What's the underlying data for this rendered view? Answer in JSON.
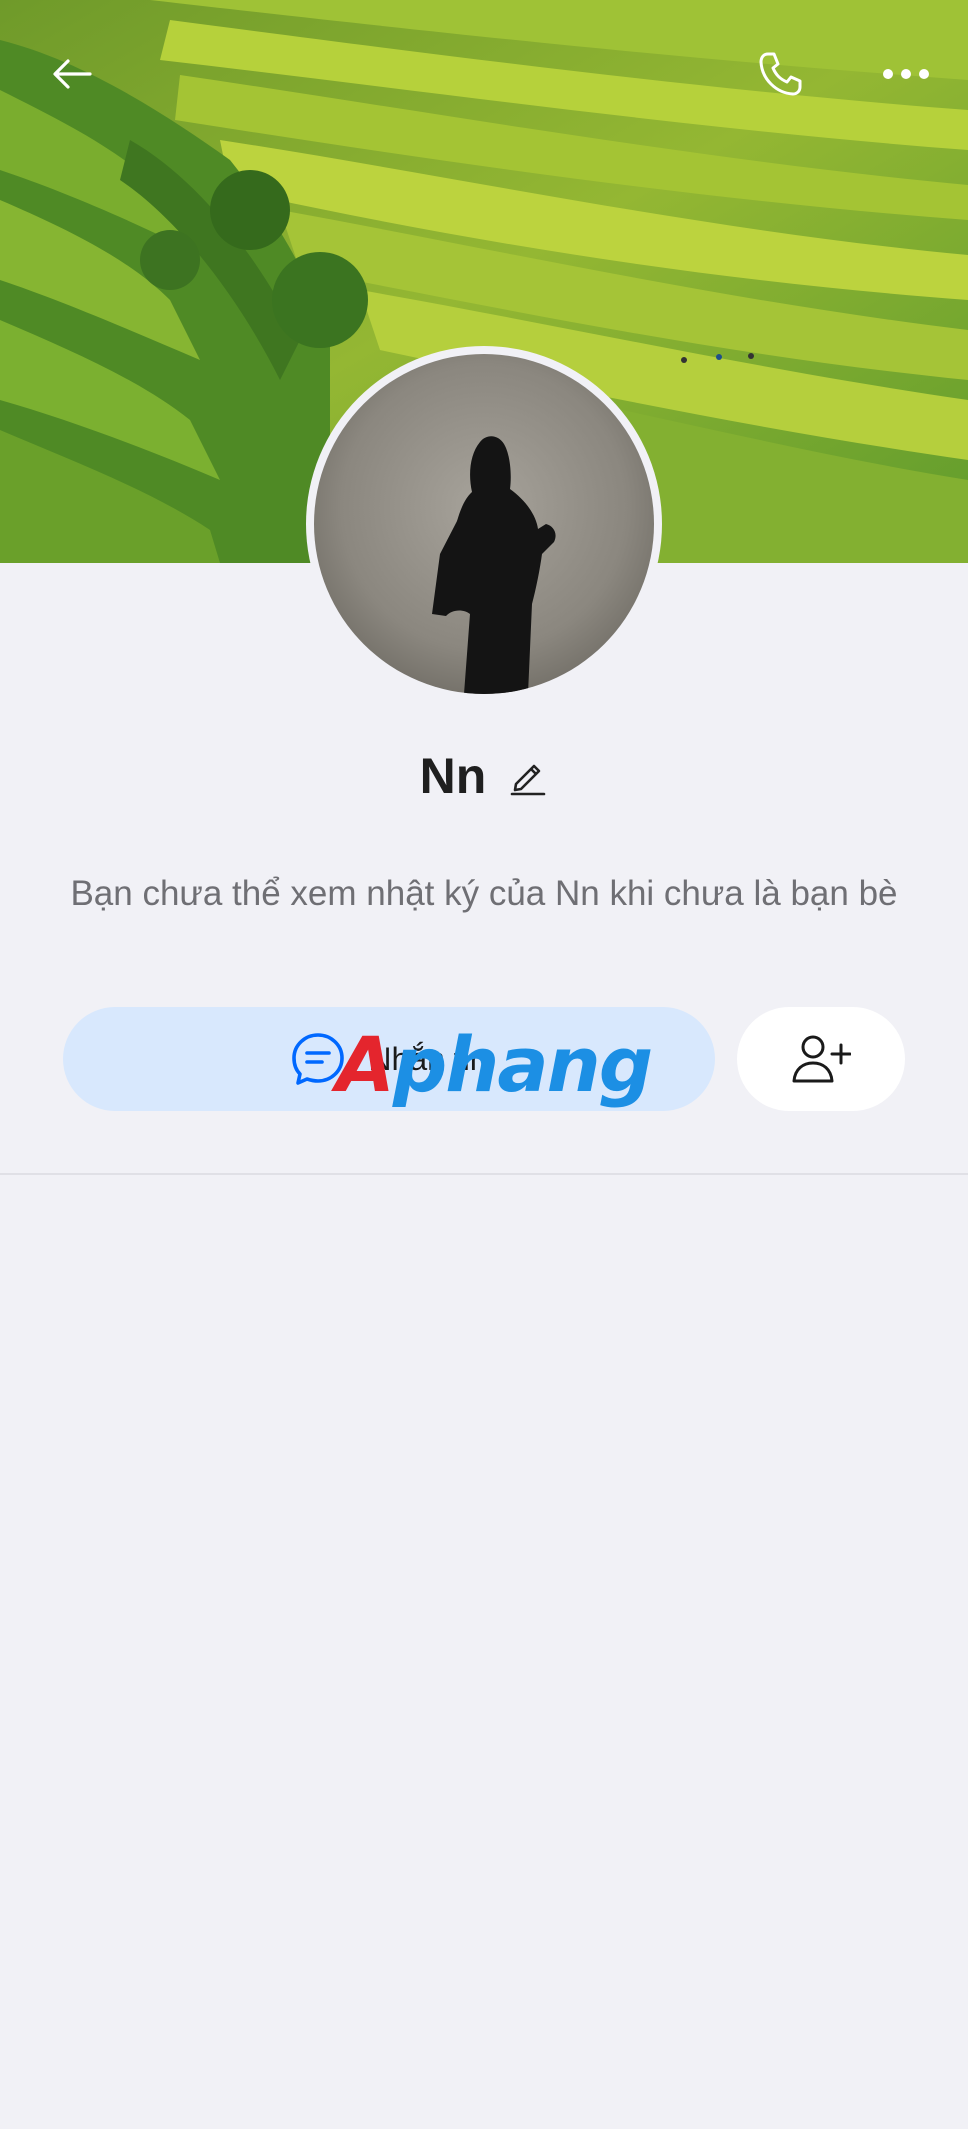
{
  "header": {
    "back_icon": "arrow-left-icon",
    "call_icon": "phone-icon",
    "more_icon": "more-horizontal-icon"
  },
  "profile": {
    "name": "Nn",
    "edit_icon": "pencil-icon",
    "notice": "Bạn chưa thể xem nhật ký của Nn khi chưa là bạn bè"
  },
  "actions": {
    "message_label": "Nhắn tin",
    "message_icon": "chat-bubble-icon",
    "add_friend_icon": "add-user-icon"
  },
  "watermark": {
    "first": "A",
    "rest": "phang"
  },
  "colors": {
    "background": "#f1f1f6",
    "message_button": "#d8e8fd",
    "accent_blue": "#0068ff"
  }
}
